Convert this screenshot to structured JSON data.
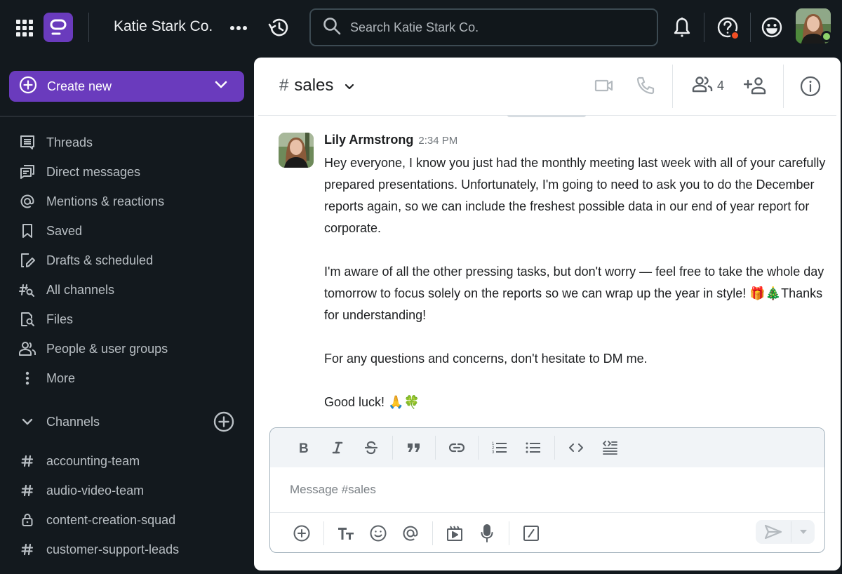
{
  "topbar": {
    "workspace_name": "Katie Stark Co.",
    "search_placeholder": "Search Katie Stark Co.",
    "icons": [
      "apps-grid-icon",
      "app-logo",
      "more-horizontal-icon",
      "history-icon",
      "search-icon",
      "bell-icon",
      "help-icon",
      "emoji-status-icon",
      "user-avatar"
    ],
    "help_badge_color": "#f04e23",
    "presence_color": "#8fd36b"
  },
  "sidebar": {
    "create_new_label": "Create new",
    "accent_color": "#6a3bbd",
    "nav_items": [
      {
        "label": "Threads",
        "icon": "threads-icon"
      },
      {
        "label": "Direct messages",
        "icon": "direct-messages-icon"
      },
      {
        "label": "Mentions & reactions",
        "icon": "at-icon"
      },
      {
        "label": "Saved",
        "icon": "bookmark-icon"
      },
      {
        "label": "Drafts & scheduled",
        "icon": "draft-edit-icon"
      },
      {
        "label": "All channels",
        "icon": "channel-search-icon"
      },
      {
        "label": "Files",
        "icon": "file-search-icon"
      },
      {
        "label": "People & user groups",
        "icon": "people-icon"
      },
      {
        "label": "More",
        "icon": "more-vertical-icon"
      }
    ],
    "channels_section_label": "Channels",
    "channels": [
      {
        "name": "accounting-team",
        "type": "public"
      },
      {
        "name": "audio-video-team",
        "type": "public"
      },
      {
        "name": "content-creation-squad",
        "type": "private"
      },
      {
        "name": "customer-support-leads",
        "type": "public"
      }
    ]
  },
  "channel": {
    "hash": "#",
    "name": "sales",
    "member_count": "4"
  },
  "message": {
    "author": "Lily Armstrong",
    "time": "2:34 PM",
    "paragraphs": [
      "Hey everyone, I know you just had the monthly meeting last week with all of your carefully prepared presentations. Unfortunately, I'm going to need to ask you to do the December reports again, so we can include the freshest possible data in our end of year report for corporate.",
      "I'm aware of all the other pressing tasks, but don't worry — feel free to take the whole day tomorrow to focus solely on the reports so we can wrap up the year in style! 🎁🎄Thanks for understanding!",
      "For any questions and concerns, don't hesitate to DM me.",
      "Good luck! 🙏🍀"
    ]
  },
  "composer": {
    "placeholder": "Message #sales",
    "format_buttons": [
      "bold",
      "italic",
      "strikethrough",
      "quote",
      "link",
      "numbered-list",
      "bulleted-list",
      "code",
      "code-block"
    ],
    "action_buttons": [
      "attach",
      "text-format",
      "emoji",
      "mention",
      "video-clip",
      "voice-message",
      "slash-command"
    ]
  }
}
